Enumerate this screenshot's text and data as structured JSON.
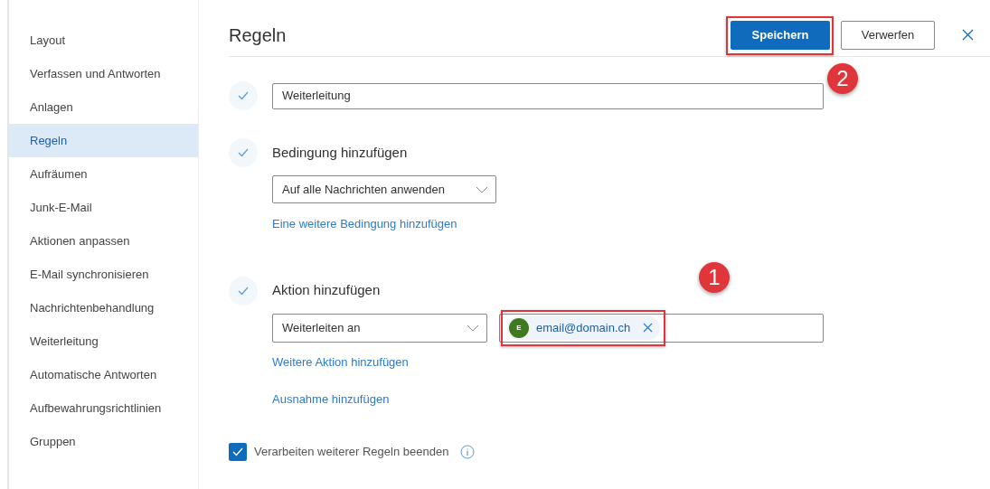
{
  "sidebar": {
    "items": [
      {
        "label": "Layout",
        "selected": false
      },
      {
        "label": "Verfassen und Antworten",
        "selected": false
      },
      {
        "label": "Anlagen",
        "selected": false
      },
      {
        "label": "Regeln",
        "selected": true
      },
      {
        "label": "Aufräumen",
        "selected": false
      },
      {
        "label": "Junk-E-Mail",
        "selected": false
      },
      {
        "label": "Aktionen anpassen",
        "selected": false
      },
      {
        "label": "E-Mail synchronisieren",
        "selected": false
      },
      {
        "label": "Nachrichtenbehandlung",
        "selected": false
      },
      {
        "label": "Weiterleitung",
        "selected": false
      },
      {
        "label": "Automatische Antworten",
        "selected": false
      },
      {
        "label": "Aufbewahrungsrichtlinien",
        "selected": false
      },
      {
        "label": "Gruppen",
        "selected": false
      }
    ]
  },
  "header": {
    "title": "Regeln",
    "buttons": [
      {
        "label": "Speichern",
        "kind": "primary",
        "annotation": "2"
      },
      {
        "label": "Verwerfen",
        "kind": "secondary"
      }
    ]
  },
  "rule_name": {
    "value": "Weiterleitung"
  },
  "condition": {
    "heading": "Bedingung hinzufügen",
    "dropdown": "Auf alle Nachrichten anwenden",
    "link": "Eine weitere Bedingung hinzufügen"
  },
  "action": {
    "heading": "Aktion hinzufügen",
    "dropdown": "Weiterleiten an",
    "recipient": {
      "initial": "E",
      "email": "email@domain.ch",
      "annotation": "1"
    },
    "links": [
      "Weitere Aktion hinzufügen",
      "Ausnahme hinzufügen"
    ]
  },
  "stop_processing": {
    "label": "Verarbeiten weiterer Regeln beenden",
    "checked": true
  }
}
